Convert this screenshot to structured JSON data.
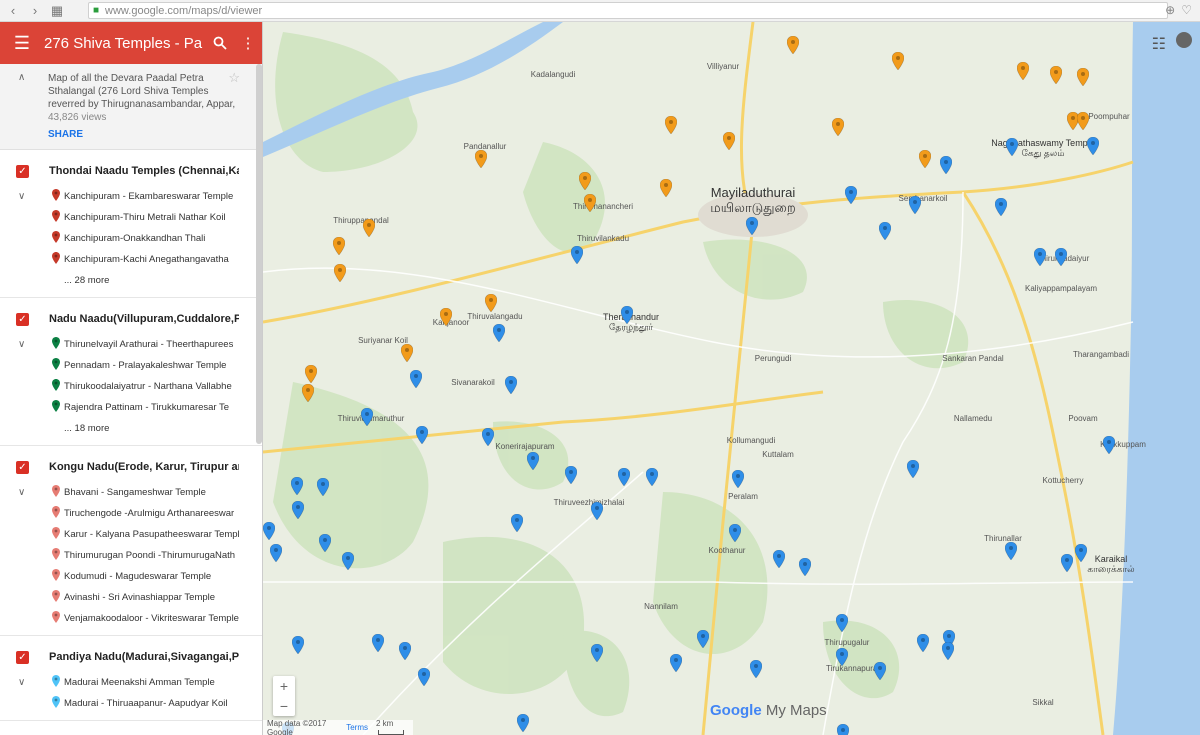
{
  "browser": {
    "url": "www.google.com/maps/d/viewer"
  },
  "panel": {
    "title": "276 Shiva Temples - Pa",
    "description": "Map of all the Devara Paadal Petra Sthalangal (276 Lord Shiva Temples reverred by Thirugnanasambandar, Appar,",
    "views": "43,826 views",
    "share_label": "SHARE"
  },
  "layers": [
    {
      "title": "Thondai Naadu Temples (Chennai,Ka",
      "pin_color": "#c53929",
      "items": [
        "Kanchipuram - Ekambareswarar Temple",
        "Kanchipuram-Thiru Metrali Nathar Koil",
        "Kanchipuram-Onakkandhan Thali",
        "Kanchipuram-Kachi Anegathangavatha"
      ],
      "more": "... 28 more"
    },
    {
      "title": "Nadu Naadu(Villupuram,Cuddalore,P",
      "pin_color": "#0b8043",
      "items": [
        "Thirunelvayil Arathurai - Theerthapurees",
        "Pennadam - Pralayakaleshwar Temple",
        "Thirukoodalaiyatrur - Narthana Vallabhe",
        "Rajendra Pattinam - Tirukkumaresar Te"
      ],
      "more": "... 18 more"
    },
    {
      "title": "Kongu Nadu(Erode, Karur, Tirupur and",
      "pin_color": "#e67c73",
      "items": [
        "Bhavani - Sangameshwar Temple",
        "Tiruchengode -Arulmigu Arthanareeswar",
        "Karur - Kalyana Pasupatheeswarar Temple",
        "Thirumurugan Poondi -ThirumurugaNath",
        "Kodumudi - Magudeswarar Temple",
        "Avinashi - Sri Avinashiappar Temple",
        "Venjamakoodaloor - Vikriteswarar Temple"
      ],
      "more": ""
    },
    {
      "title": "Pandiya Nadu(Madurai,Sivagangai,Pu",
      "pin_color": "#4fc3f7",
      "items": [
        "Madurai Meenakshi Amman Temple",
        "Madurai - Thiruaapanur- Aapudyar Koil"
      ],
      "more": ""
    }
  ],
  "map": {
    "labels": {
      "mayiladuthurai": "Mayiladuthurai",
      "mayiladuthurai_ta": "மயிலாடுதுறை",
      "karaikal": "Karaikal",
      "karaikal_ta": "காரைக்கால்",
      "therazhandur": "Therazhandur",
      "therazhandur_ta": "தேரழந்தூர்",
      "nagan": "Naganathaswamy Temple",
      "nagan_ta": "கேது தலம்",
      "poompuhar": "Poompuhar",
      "kanjanoor": "Kanjanoor",
      "konerirajapuram": "Konerirajapuram",
      "thiruvidaimaruthur": "Thiruvidaimaruthur",
      "thiruvalangadu": "Thiruvalangadu",
      "kumbakonam_hint": "Suriyanar Koil",
      "kuttalam": "Kuttalam",
      "peralam": "Peralam",
      "nannilam": "Nannilam",
      "thirumanancheri": "Thirumanancheri",
      "thiruvilankadu": "Thiruvilankadu",
      "sembanarkoil": "Sembanarkoil",
      "thirukkadaiyur": "Thirukkadaiyur",
      "tharangambadi": "Tharangambadi",
      "kalliyappampalayam": "Kaliyappampalayam",
      "pandanallur": "Pandanallur",
      "thiruppanandal": "Thiruppanandal",
      "kollumangudi": "Kollumangudi",
      "poovam": "Poovam",
      "kalikuppam": "Kalikkuppam",
      "kottucherry": "Kottucherry",
      "thirunallar": "Thirunallar",
      "koothanur": "Koothanur",
      "thiruvarur_hint": "Thiruveezhimizhalai",
      "sivanarkoil": "Sivanarakoil",
      "kadalangudi": "Kadalangudi",
      "villiyanur": "Villiyanur",
      "perungudi": "Perungudi",
      "sankarapandal": "Sankaran Pandal",
      "nallamedu": "Nallamedu",
      "thirupugalur": "Thirupugalur",
      "tirukannapuram": "Tirukannapuram",
      "sikkal": "Sikkal"
    },
    "brand_google": "Google",
    "brand_my_maps": "My Maps",
    "attribution": "Map data ©2017 Google",
    "terms": "Terms",
    "scale": "2 km"
  },
  "colors": {
    "header": "#db4437",
    "orange_pin": "#f29b1b",
    "blue_pin": "#2f8ee8",
    "green_area": "#cfe3c0",
    "water": "#a8ccee"
  }
}
